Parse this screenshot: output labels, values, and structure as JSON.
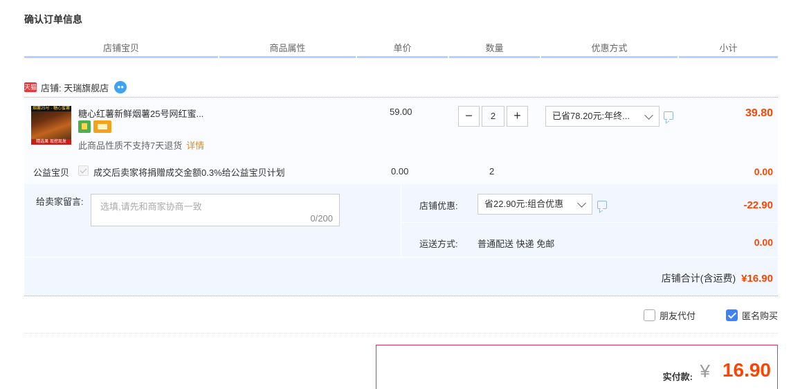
{
  "page_title": "确认订单信息",
  "columns": [
    "店铺宝贝",
    "商品属性",
    "单价",
    "数量",
    "优惠方式",
    "小计"
  ],
  "shop": {
    "badge": "天猫",
    "label": "店铺: 天瑞旗舰店"
  },
  "item": {
    "name": "糖心红薯新鲜烟薯25号网红蜜...",
    "thumb_top": "烟薯25号 · 糖心蜜薯",
    "thumb_bottom": "精选果 现挖现发",
    "return_note": "此商品性质不支持7天退货",
    "detail_link": "详情",
    "unit_price": "59.00",
    "quantity": "2",
    "minus": "−",
    "plus": "+",
    "promo": "已省78.20元:年终...",
    "subtotal": "39.80"
  },
  "charity": {
    "label": "公益宝贝",
    "text": "成交后卖家将捐赠成交金额0.3%给公益宝贝计划",
    "price": "0.00",
    "qty": "2",
    "subtotal": "0.00"
  },
  "message": {
    "label": "给卖家留言:",
    "placeholder": "选填,请先和商家协商一致",
    "count": "0/200"
  },
  "shop_promo": {
    "label": "店铺优惠:",
    "value": "省22.90元:组合优惠",
    "amount": "-22.90"
  },
  "shipping": {
    "label": "运送方式:",
    "method": "普通配送 快递 免邮",
    "amount": "0.00"
  },
  "shop_total": {
    "label": "店铺合计(含运费)",
    "amount": "¥16.90"
  },
  "options": {
    "friend_pay": "朋友代付",
    "anonymous": "匿名购买"
  },
  "payment": {
    "label": "实付款:",
    "currency": "¥",
    "amount": "16.90"
  },
  "colors": {
    "price_red": "#ff4400",
    "header_line": "#b2d1ff",
    "checkbox_blue": "#3d82f6",
    "pay_border": "#f02d5a"
  }
}
